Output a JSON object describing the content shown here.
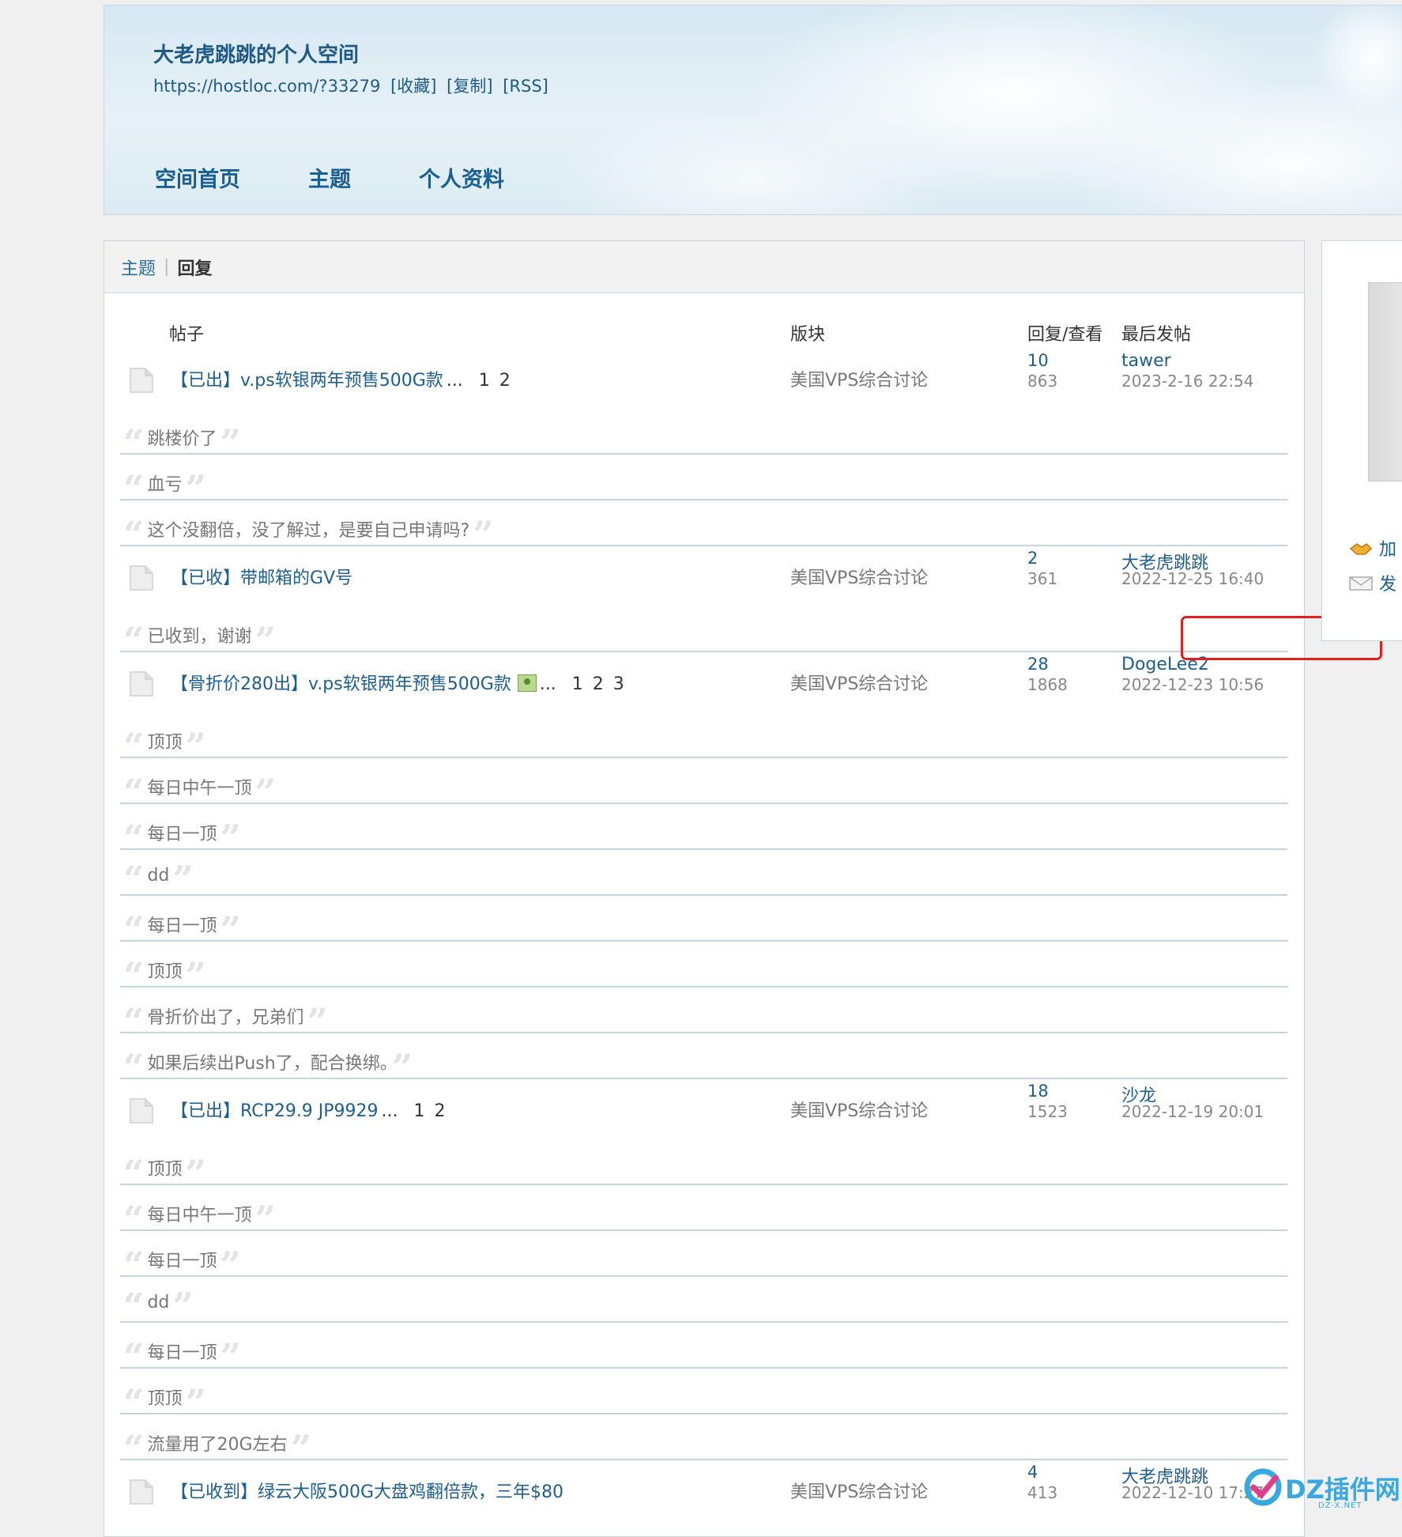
{
  "header": {
    "title": "大老虎跳跳的个人空间",
    "url": "https://hostloc.com/?33279",
    "links": [
      "[收藏]",
      "[复制]",
      "[RSS]"
    ],
    "nav": [
      "空间首页",
      "主题",
      "个人资料"
    ]
  },
  "tabs": {
    "inactive": "主题",
    "active": "回复"
  },
  "columns": {
    "post": "帖子",
    "forum": "版块",
    "replies_views": "回复/查看",
    "last_post": "最后发帖"
  },
  "threads": [
    {
      "title": "【已出】v.ps软银两年预售500G款",
      "ellipsis": "...",
      "pages": [
        "1",
        "2"
      ],
      "forum": "美国VPS综合讨论",
      "replies": "10",
      "views": "863",
      "last_user": "tawer",
      "last_time": "2023-2-16 22:54",
      "quotes": [
        "跳楼价了",
        "血亏",
        "这个没翻倍，没了解过，是要自己申请吗?"
      ]
    },
    {
      "title": "【已收】带邮箱的GV号",
      "ellipsis": "",
      "pages": [],
      "forum": "美国VPS综合讨论",
      "replies": "2",
      "views": "361",
      "last_user": "大老虎跳跳",
      "last_time": "2022-12-25 16:40",
      "quotes": [
        "已收到，谢谢"
      ]
    },
    {
      "title": "【骨折价280出】v.ps软银两年预售500G款",
      "ellipsis": "...",
      "pages": [
        "1",
        "2",
        "3"
      ],
      "has_image_icon": true,
      "forum": "美国VPS综合讨论",
      "replies": "28",
      "views": "1868",
      "last_user": "DogeLee2",
      "last_time": "2022-12-23 10:56",
      "quotes": [
        "顶顶",
        "每日中午一顶",
        "每日一顶",
        "dd",
        "每日一顶",
        "顶顶",
        "骨折价出了，兄弟们",
        "如果后续出Push了，配合换绑。"
      ]
    },
    {
      "title": "【已出】RCP29.9 JP9929",
      "ellipsis": "...",
      "pages": [
        "1",
        "2"
      ],
      "forum": "美国VPS综合讨论",
      "replies": "18",
      "views": "1523",
      "last_user": "沙龙",
      "last_time": "2022-12-19 20:01",
      "quotes": [
        "顶顶",
        "每日中午一顶",
        "每日一顶",
        "dd",
        "每日一顶",
        "顶顶",
        "流量用了20G左右"
      ]
    },
    {
      "title": "【已收到】绿云大阪500G大盘鸡翻倍款，三年$80",
      "ellipsis": "",
      "pages": [],
      "forum": "美国VPS综合讨论",
      "replies": "4",
      "views": "413",
      "last_user": "大老虎跳跳",
      "last_time": "2022-12-10 17:27",
      "quotes": []
    }
  ],
  "sidebar": {
    "actions": [
      "加",
      "发"
    ]
  },
  "watermark": {
    "text": "DZ插件网",
    "sub": "DZ-X.NET"
  },
  "colors": {
    "link": "#1d5e93",
    "highlight": "#e0201a"
  }
}
